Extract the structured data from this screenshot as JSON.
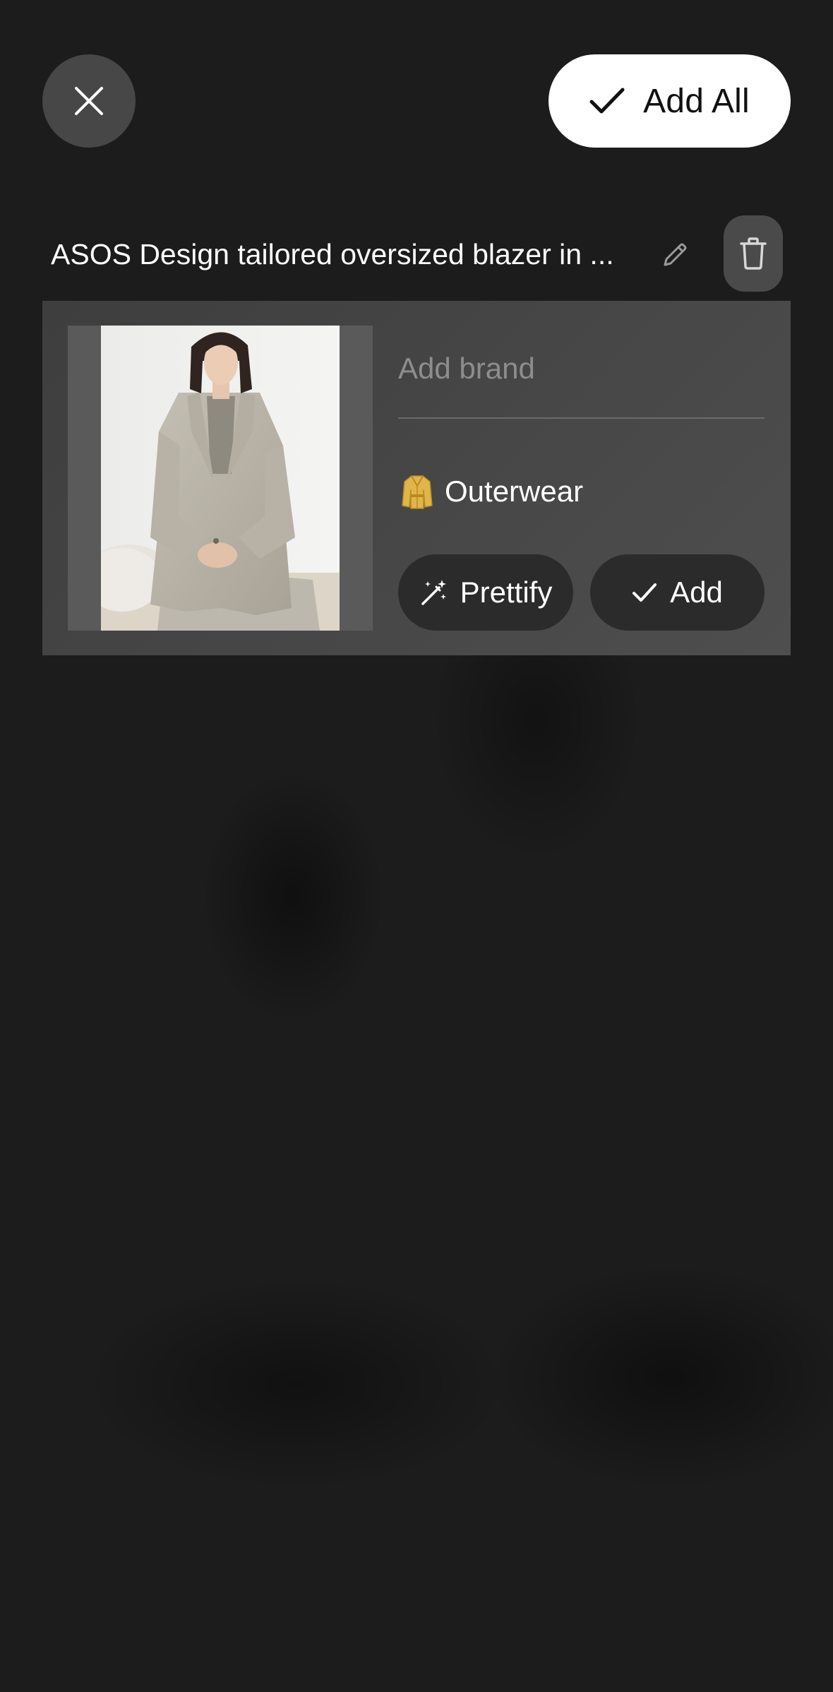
{
  "header": {
    "close_icon": "close-icon",
    "add_all_label": "Add All",
    "add_all_icon": "check-icon"
  },
  "item": {
    "title": "ASOS Design tailored oversized blazer in ...",
    "edit_icon": "pencil-icon",
    "delete_icon": "trash-icon",
    "photo_alt": "Model wearing a grey oversized blazer and trousers, seated",
    "brand_placeholder": "Add brand",
    "brand_value": "",
    "category_icon": "coat-icon",
    "category_label": "Outerwear",
    "prettify_label": "Prettify",
    "prettify_icon": "magic-wand-icon",
    "add_label": "Add",
    "add_icon": "check-icon"
  },
  "colors": {
    "background": "#1c1c1c",
    "card": "#474747",
    "pill": "#2b2b2b",
    "primary_button": "#ffffff",
    "placeholder": "#8d8d8d",
    "coat_icon": "#e0b64a"
  }
}
